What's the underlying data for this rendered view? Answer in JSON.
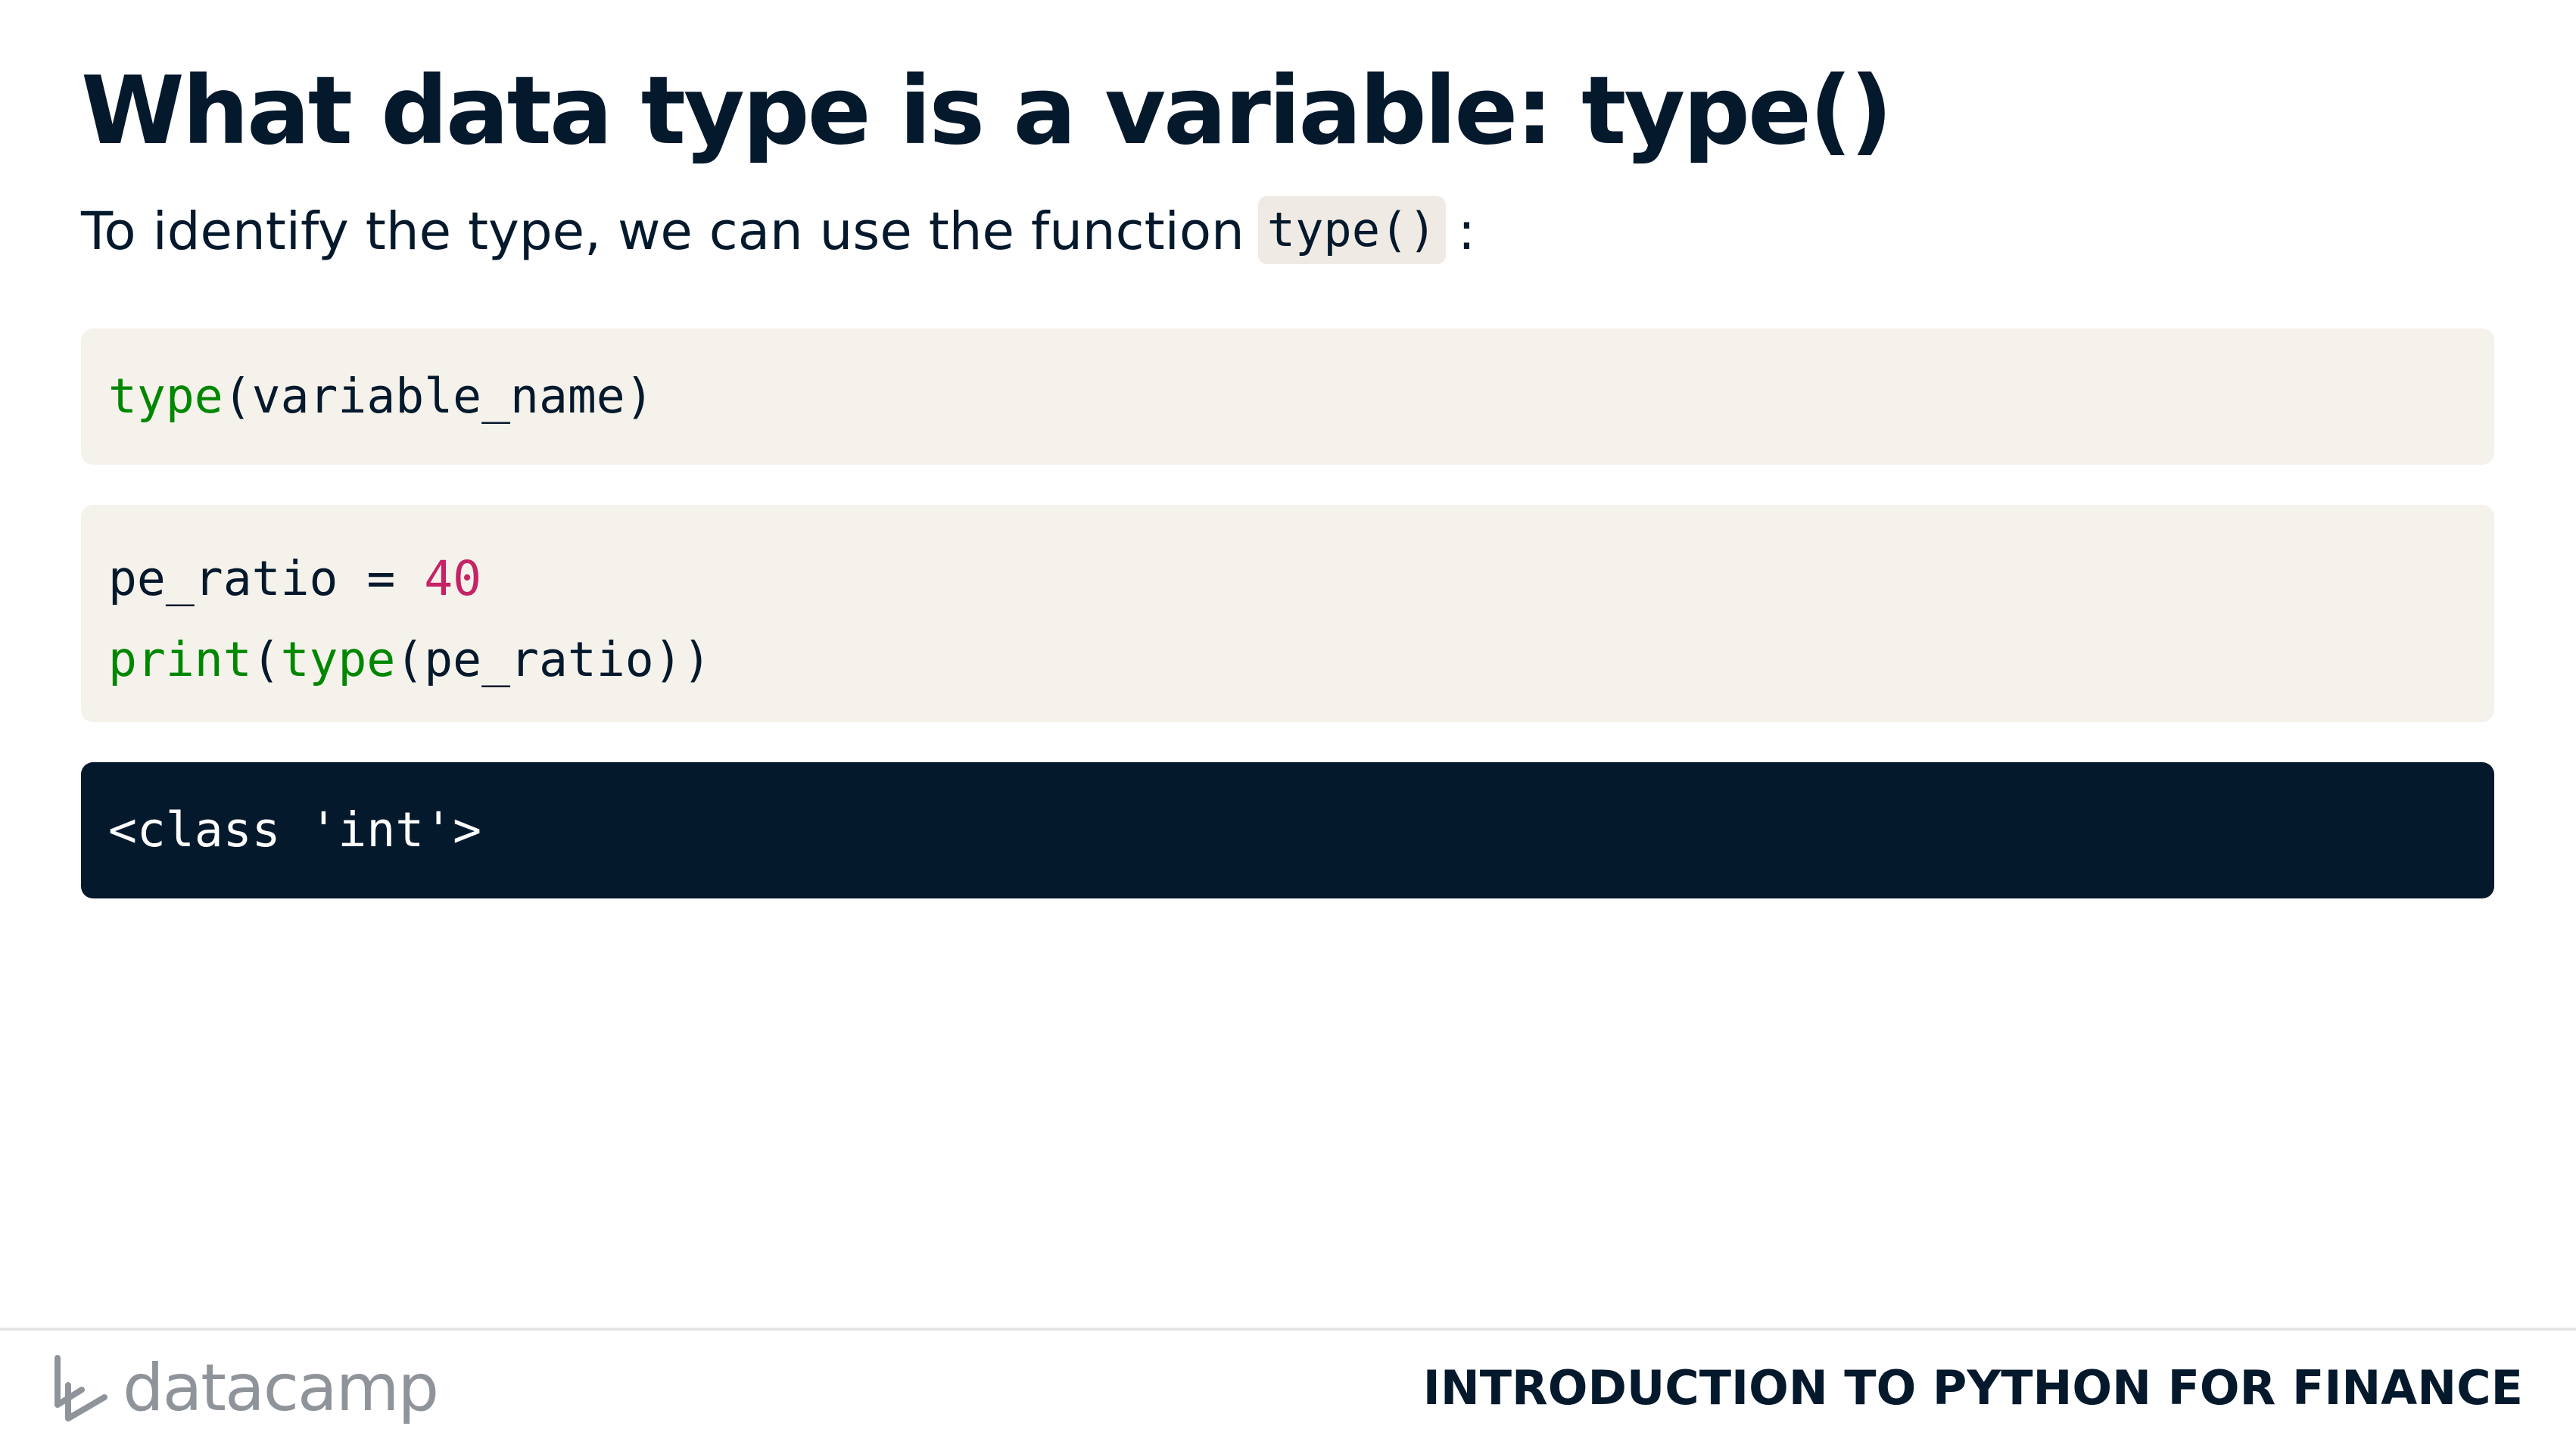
{
  "slide": {
    "title": "What data type is a variable: type()",
    "intro_text": "To identify the type, we can use the function",
    "intro_code": "type()",
    "intro_suffix": ":"
  },
  "code_blocks": [
    {
      "lines": [
        [
          {
            "text": "type",
            "kind": "keyword"
          },
          {
            "text": "(variable_name)",
            "kind": "plain"
          }
        ]
      ]
    },
    {
      "lines": [
        [
          {
            "text": "pe_ratio = ",
            "kind": "plain"
          },
          {
            "text": "40",
            "kind": "number"
          }
        ],
        [
          {
            "text": "print",
            "kind": "keyword"
          },
          {
            "text": "(",
            "kind": "plain"
          },
          {
            "text": "type",
            "kind": "keyword"
          },
          {
            "text": "(pe_ratio))",
            "kind": "plain"
          }
        ]
      ]
    }
  ],
  "output": "<class 'int'>",
  "footer": {
    "logo_text": "datacamp",
    "logo_icon": "datacamp-logo-icon",
    "course_title": "INTRODUCTION TO PYTHON FOR FINANCE"
  },
  "colors": {
    "text": "#05192d",
    "code_background": "#f5f2eb",
    "output_background": "#05192d",
    "keyword": "#008700",
    "number": "#c52365",
    "logo": "#8f949b"
  }
}
